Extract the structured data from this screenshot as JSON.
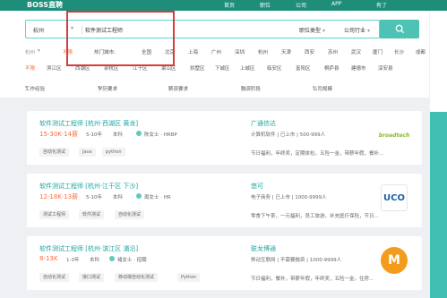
{
  "topbar": {
    "logo": "BOSS直聘",
    "nav": [
      "首页",
      "职位",
      "公司",
      "APP",
      "有了"
    ]
  },
  "search": {
    "city": "杭州",
    "query": "软件测试工程师",
    "filter_position": "职位类型",
    "filter_industry": "公司行业"
  },
  "hot_cities": {
    "label": "热门城市:",
    "current": "不限",
    "items": [
      "全国",
      "北京",
      "上海",
      "广州",
      "深圳",
      "杭州",
      "天津",
      "西安",
      "苏州",
      "武汉",
      "厦门",
      "长沙",
      "成都",
      "郑州"
    ]
  },
  "districts": {
    "current": "不限",
    "items": [
      "滨江区",
      "西湖区",
      "余杭区",
      "江干区",
      "萧山区",
      "拱墅区",
      "下城区",
      "上城区",
      "临安区",
      "富阳区",
      "桐庐县",
      "建德市",
      "淳安县"
    ]
  },
  "filters": [
    "工作经验",
    "学历要求",
    "薪资要求",
    "融资阶段",
    "公司规模"
  ],
  "jobs": [
    {
      "title": "软件测试工程师 [杭州·西湖区 黄龙]",
      "salary": "15-30K·14薪",
      "experience": "5-10年",
      "education": "本科",
      "recruiter": "陈女士 · HRBP",
      "tags": [
        "自动化测试",
        "Java",
        "python"
      ],
      "company": "广通信达",
      "company_info": "计算机软件  |  已上市  |  500-999人",
      "benefits": "节日福利，年终奖，定期体检，五险一金，带薪年假，餐补...",
      "logo_text": "broadtech",
      "logo_color": "#8ab92d"
    },
    {
      "title": "软件测试工程师 [杭州·江干区 下沙]",
      "salary": "12-18K·13薪",
      "experience": "5-10年",
      "education": "本科",
      "recruiter": "周女士 · HR",
      "tags": [
        "测试工程师",
        "软件测试",
        "自动化测试"
      ],
      "company": "悠可",
      "company_info": "电子商务  |  已上市  |  1000-9999人",
      "benefits": "零食下午茶，一元福利，员工旅游，补充医疗保险，节日...",
      "logo_text": "UCO",
      "logo_color": "#1f5fa8"
    },
    {
      "title": "软件测试工程师 [杭州·滨江区 浦沿]",
      "salary": "8-13K",
      "experience": "1-3年",
      "education": "本科",
      "recruiter": "褚女士 · 招聘",
      "tags": [
        "自动化测试",
        "接口测试",
        "移动端自动化测试",
        "Python"
      ],
      "company": "联龙博通",
      "company_info": "移动互联网  |  不需要融资  |  1000-9999人",
      "benefits": "节日福利，餐补，带薪年假，年终奖，五险一金，住房...",
      "logo_text": "M",
      "logo_color": "#f39b1b"
    }
  ]
}
